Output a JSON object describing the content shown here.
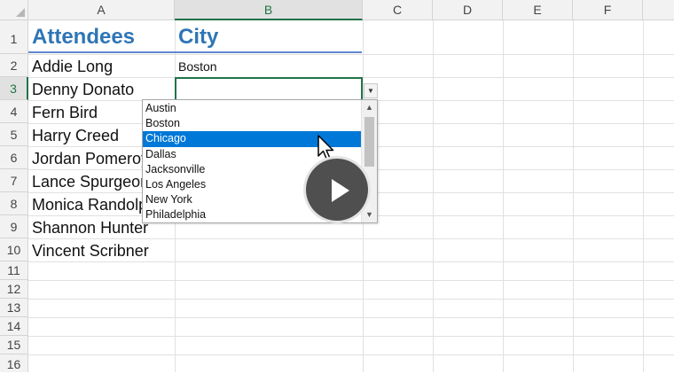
{
  "columns": [
    "A",
    "B",
    "C",
    "D",
    "E",
    "F"
  ],
  "rows": [
    "1",
    "2",
    "3",
    "4",
    "5",
    "6",
    "7",
    "8",
    "9",
    "10",
    "11",
    "12",
    "13",
    "14",
    "15",
    "16"
  ],
  "headers": {
    "attendees": "Attendees",
    "city": "City"
  },
  "attendees": [
    "Addie Long",
    "Denny Donato",
    "Fern Bird",
    "Harry Creed",
    "Jordan Pomeroy",
    "Lance Spurgeon",
    "Monica Randolph",
    "Shannon Hunter",
    "Vincent Scribner"
  ],
  "cities_entered": {
    "row2": "Boston"
  },
  "active_cell": "B3",
  "dropdown": {
    "options": [
      "Austin",
      "Boston",
      "Chicago",
      "Dallas",
      "Jacksonville",
      "Los Angeles",
      "New York",
      "Philadelphia"
    ],
    "highlighted": "Chicago",
    "scroll_up_glyph": "▲",
    "scroll_down_glyph": "▼",
    "button_glyph": "▼"
  },
  "icons": {
    "cursor": "arrow-cursor-icon",
    "play": "play-icon"
  },
  "colors": {
    "selection": "#217346",
    "header_text": "#2f75b5",
    "list_highlight": "#0078d7"
  }
}
